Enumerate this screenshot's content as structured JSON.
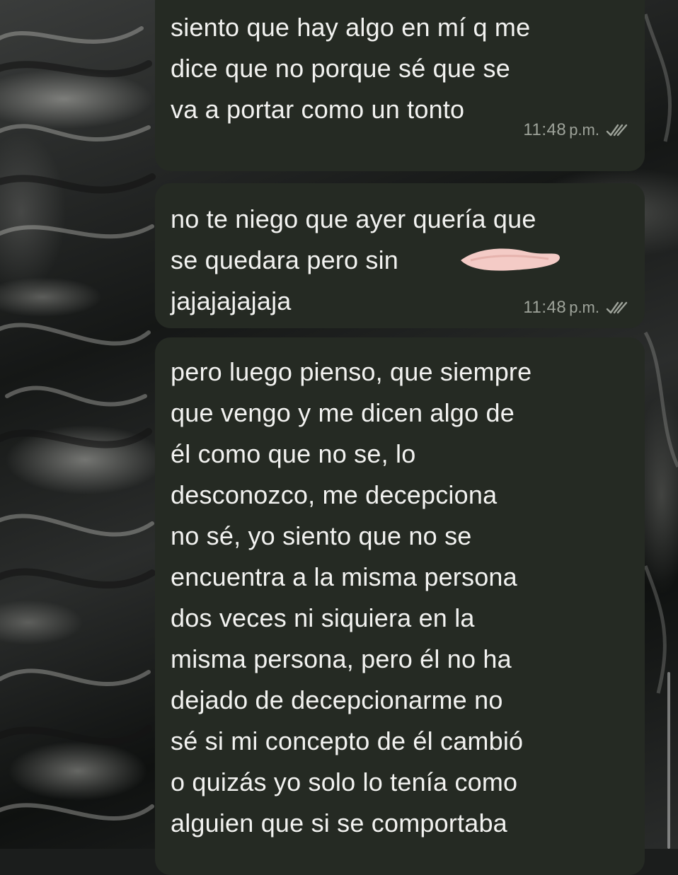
{
  "colors": {
    "bubble_bg": "#252a23",
    "bubble_text": "#f2f2f0",
    "meta_text": "#9ea39a",
    "redaction": "#f4cbc6"
  },
  "messages": [
    {
      "text": "siento que hay algo en mí q me\ndice que no porque sé que se\nva a portar como un tonto",
      "time": "11:48",
      "suffix": "p.m.",
      "status_icon": "double-check-icon"
    },
    {
      "text": "no te niego que ayer quería que\nse quedara pero sin\njajajajajaja",
      "time": "11:48",
      "suffix": "p.m.",
      "status_icon": "double-check-icon"
    },
    {
      "text": "pero luego pienso, que siempre\nque vengo y me dicen algo de\nél como que no se, lo\ndesconozco, me decepciona\nno sé, yo siento que no se\nencuentra a la misma persona\ndos veces ni siquiera en la\nmisma persona, pero él no ha\ndejado de decepcionarme no\nsé si mi concepto de él cambió\no quizás yo solo lo tenía como\nalguien que si se comportaba"
    }
  ]
}
